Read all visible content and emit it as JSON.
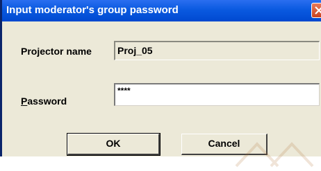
{
  "window": {
    "title": "Input moderator's group password"
  },
  "form": {
    "projector_label": "Projector name",
    "projector_value": "Proj_05",
    "password_label_first": "P",
    "password_label_rest": "assword",
    "password_value": "****"
  },
  "buttons": {
    "ok_label": "OK",
    "cancel_label": "Cancel"
  },
  "icons": {
    "close": "close-icon"
  },
  "colors": {
    "titlebar": "#0a5ae0",
    "dialog_bg": "#ece9d8",
    "close_button": "#c8421e"
  }
}
